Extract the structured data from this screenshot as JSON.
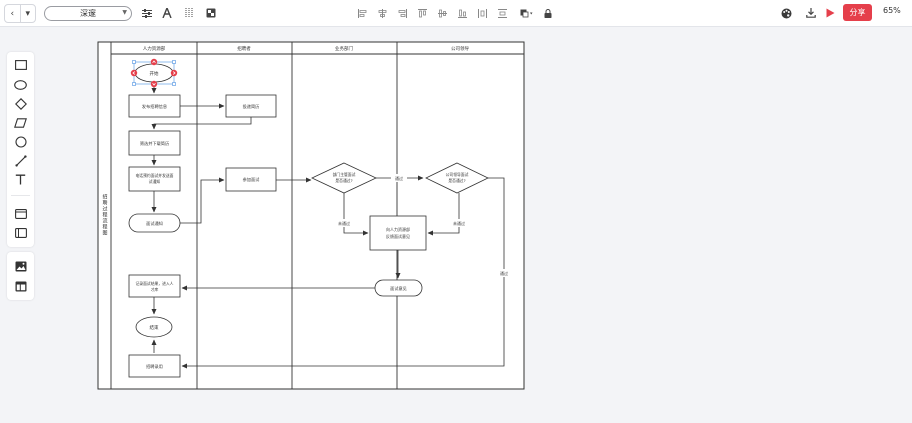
{
  "toolbar": {
    "nav_back": "‹",
    "nav_menu": "▾",
    "font_family": "深邃",
    "share_label": "分享",
    "zoom_level": "65%"
  },
  "accent_color": "#e53f4b",
  "diagram": {
    "pool_title": "招聘过程流程图",
    "lanes": [
      "人力资源部",
      "招聘者",
      "业务部门",
      "公司领导"
    ],
    "nodes": {
      "start": "开始",
      "publish": "发布招聘信息",
      "submit": "投递简历",
      "screen": "筛选并下载简历",
      "phone_line1": "电话预约面试并发送面",
      "phone_line2": "试通知",
      "notice": "面试通知",
      "attend": "参加面试",
      "dept_line1": "部门主管面试",
      "dept_line2": "是否通过?",
      "lead_line1": "公司领导面试",
      "lead_line2": "是否通过?",
      "feedback_line1": "向人力资源部",
      "feedback_line2": "反馈面试意见",
      "opinion": "面试意见",
      "record_line1": "记录面试结果，进入人",
      "record_line2": "才库",
      "end": "结束",
      "hire": "招聘录用"
    },
    "edge_labels": {
      "pass1": "通过",
      "fail1": "未通过",
      "fail2": "未通过",
      "pass2": "通过"
    }
  },
  "icons": {
    "toolbar": [
      "sliders-icon",
      "text-format-icon",
      "line-style-icon",
      "fill-icon",
      "align-left-icon",
      "align-center-icon",
      "align-right-icon",
      "align-top-icon",
      "align-middle-icon",
      "align-bottom-icon",
      "distribute-h-icon",
      "distribute-v-icon",
      "arrange-icon",
      "lock-icon",
      "palette-icon",
      "download-icon",
      "present-icon"
    ],
    "palette": [
      "rectangle-icon",
      "ellipse-icon",
      "diamond-icon",
      "parallelogram-icon",
      "circle-icon",
      "connector-icon",
      "text-icon",
      "container-icon",
      "swimlane-icon",
      "image-icon",
      "template-icon"
    ]
  }
}
